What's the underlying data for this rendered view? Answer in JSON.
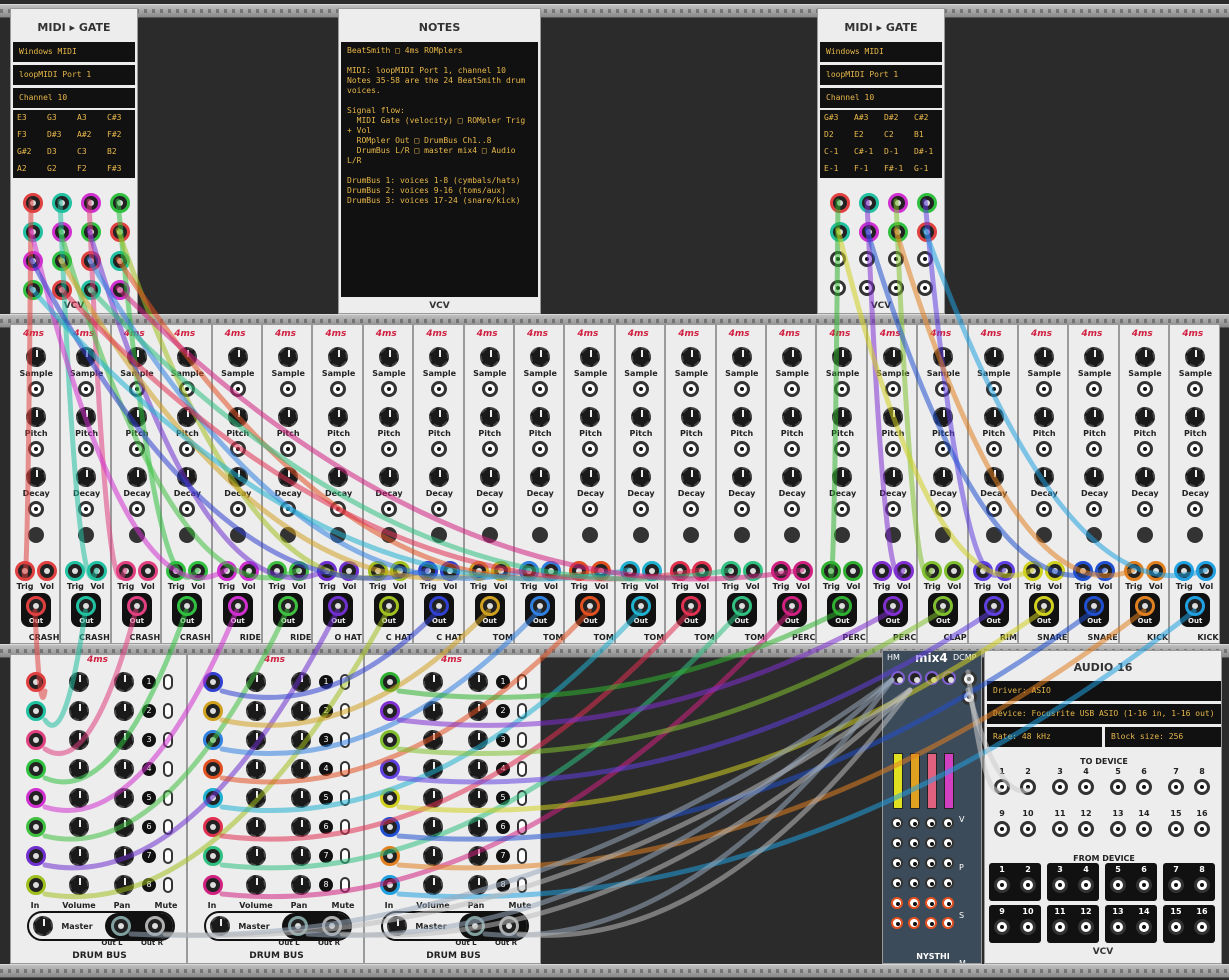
{
  "midi_gate_left": {
    "title": "MIDI ▸ GATE",
    "driver": "Windows MIDI",
    "device": "loopMIDI Port 1",
    "channel": "Channel 10",
    "notes": [
      "E3",
      "G3",
      "A3",
      "C#3",
      "F3",
      "D#3",
      "A#2",
      "F#2",
      "G#2",
      "D3",
      "C3",
      "B2",
      "A2",
      "G2",
      "F2",
      "F#3"
    ],
    "brand": "VCV"
  },
  "notes_panel": {
    "title": "NOTES",
    "lines": [
      "BeatSmith □ 4ms ROMplers",
      "",
      "MIDI: loopMIDI Port 1, channel 10",
      "Notes 35-58 are the 24 BeatSmith drum",
      "voices.",
      "",
      "Signal flow:",
      "  MIDI Gate (velocity) □ ROMpler Trig",
      "+ Vol",
      "  ROMpler Out □ DrumBus Ch1..8",
      "  DrumBus L/R □ master mix4 □ Audio",
      "L/R",
      "",
      "DrumBus 1: voices 1-8 (cymbals/hats)",
      "DrumBus 2: voices 9-16 (toms/aux)",
      "DrumBus 3: voices 17-24 (snare/kick)"
    ],
    "brand": "VCV"
  },
  "midi_gate_right": {
    "title": "MIDI ▸ GATE",
    "driver": "Windows MIDI",
    "device": "loopMIDI Port 1",
    "channel": "Channel 10",
    "notes": [
      "G#3",
      "A#3",
      "D#2",
      "C#2",
      "D2",
      "E2",
      "C2",
      "B1",
      "C-1",
      "C#-1",
      "D-1",
      "D#-1",
      "E-1",
      "F-1",
      "F#-1",
      "G-1"
    ],
    "brand": "VCV"
  },
  "rompler": {
    "knob_labels": {
      "sample": "Sample",
      "pitch": "Pitch",
      "decay": "Decay"
    },
    "jack_labels": {
      "trig": "Trig",
      "vol": "Vol",
      "out": "Out"
    },
    "voices": [
      "CRASH",
      "CRASH",
      "CRASH",
      "CRASH",
      "RIDE",
      "RIDE",
      "O HAT",
      "C HAT",
      "C HAT",
      "TOM",
      "TOM",
      "TOM",
      "TOM",
      "TOM",
      "TOM",
      "PERC",
      "PERC",
      "PERC",
      "CLAP",
      "RIM",
      "SNARE",
      "SNARE",
      "KICK",
      "KICK"
    ],
    "colors": [
      "#e04040",
      "#20c0a0",
      "#e04080",
      "#30c040",
      "#d030d0",
      "#40c040",
      "#7030d0",
      "#a0c020",
      "#3040d0",
      "#d0a020",
      "#3080e0",
      "#e05020",
      "#20b0d0",
      "#e03050",
      "#30c080",
      "#d02080",
      "#30b030",
      "#8030d0",
      "#80c030",
      "#6040e0",
      "#d0d020",
      "#2050d0",
      "#e08020",
      "#20a0e0"
    ]
  },
  "drum_bus": {
    "title": "DRUM BUS",
    "labels": {
      "in": "In",
      "volume": "Volume",
      "pan": "Pan",
      "mute": "Mute",
      "master": "Master",
      "out_l": "Out L",
      "out_r": "Out R",
      "l": "L",
      "r": "R"
    },
    "channel_numbers": [
      "1",
      "2",
      "3",
      "4",
      "5",
      "6",
      "7",
      "8"
    ],
    "colors": [
      [
        "#e04040",
        "#20c0a0",
        "#e04080",
        "#30c040",
        "#d030d0",
        "#40c040",
        "#7030d0",
        "#a0c020"
      ],
      [
        "#3040d0",
        "#d0a020",
        "#3080e0",
        "#e05020",
        "#20b0d0",
        "#e03050",
        "#30c080",
        "#d02080"
      ],
      [
        "#30b030",
        "#8030d0",
        "#80c030",
        "#6040e0",
        "#d0d020",
        "#2050d0",
        "#e08020",
        "#20a0e0"
      ]
    ]
  },
  "mix4": {
    "title": "mix4",
    "hm": "HM",
    "dcmp": "DCMP",
    "brand": "NYSTHI",
    "strip_labels": [
      "V",
      "P",
      "S",
      "M"
    ]
  },
  "audio16": {
    "title": "AUDIO 16",
    "driver": "Driver: ASIO",
    "device": "Device: Focusrite USB ASIO (1-16 in, 1-16 out)",
    "rate": "Rate: 48 kHz",
    "block": "Block size: 256",
    "to_device": "TO DEVICE",
    "from_device": "FROM DEVICE",
    "port_numbers": [
      "1",
      "2",
      "3",
      "4",
      "5",
      "6",
      "7",
      "8",
      "9",
      "10",
      "11",
      "12",
      "13",
      "14",
      "15",
      "16"
    ],
    "brand": "VCV"
  }
}
